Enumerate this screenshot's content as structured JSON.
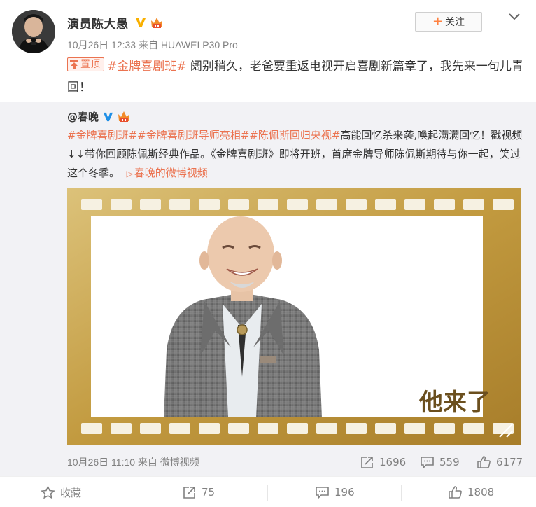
{
  "post": {
    "author": "演员陈大愚",
    "date": "10月26日 12:33",
    "source_prefix": "来自",
    "source": "HUAWEI P30 Pro",
    "follow_label": "关注",
    "pin_label": "置顶",
    "hashtag": "#金牌喜剧班#",
    "text": " 阔别稍久，老爸要重返电视开启喜剧新篇章了，我先来一句儿青回！"
  },
  "repost": {
    "author": "@春晚",
    "hashtags": [
      "#金牌喜剧班#",
      "#金牌喜剧班导师亮相#",
      "#陈佩斯回归央视#"
    ],
    "text": "高能回忆杀来袭,唤起满满回忆！戳视频↓↓带你回顾陈佩斯经典作品。《金牌喜剧班》即将开班，首席金牌导师陈佩斯期待与你一起，笑过这个冬季。",
    "video_link_label": "春晚的微博视频",
    "video_caption": "他来了",
    "date": "10月26日 11:10",
    "source_prefix": "来自",
    "source": "微博视频",
    "reposts": "1696",
    "comments": "559",
    "likes": "6177"
  },
  "bottom_bar": {
    "favorite_label": "收藏",
    "reposts": "75",
    "comments": "196",
    "likes": "1808"
  },
  "colors": {
    "accent": "#eb7350",
    "muted": "#808080",
    "repost_bg": "#f2f2f5",
    "film_gold": "#c9a650",
    "verified": "#f9b000"
  },
  "icons": {
    "verified": "verified-v-icon",
    "vip": "vip-crown-icon",
    "pin": "pin-top-icon",
    "repost": "repost-icon",
    "comment": "comment-icon",
    "like": "like-icon",
    "favorite": "star-icon",
    "menu": "chevron-down-icon",
    "video_link": "play-icon"
  }
}
